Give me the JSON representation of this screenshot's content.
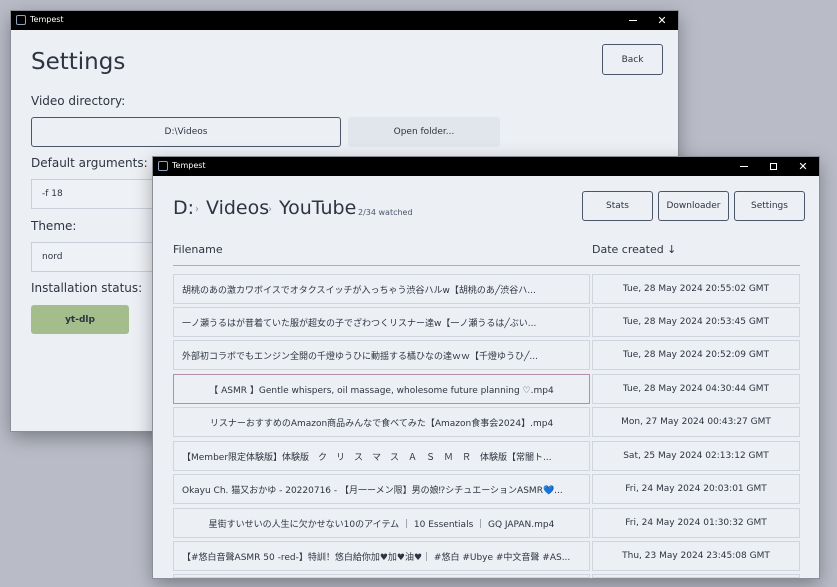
{
  "back_window": {
    "title": "Tempest",
    "heading": "Settings",
    "back_label": "Back",
    "video_directory_label": "Video directory:",
    "video_directory_value": "D:\\Videos",
    "open_folder_label": "Open folder...",
    "default_arguments_label": "Default arguments:",
    "default_arguments_value": "-f 18",
    "theme_label": "Theme:",
    "theme_value": "nord",
    "installation_status_label": "Installation status:",
    "installation_status_value": "yt-dlp",
    "status_color": "#a3be8c"
  },
  "front_window": {
    "title": "Tempest",
    "breadcrumb": [
      "D:",
      "Videos",
      "YouTube"
    ],
    "watched": "2/34 watched",
    "buttons": {
      "stats": "Stats",
      "downloader": "Downloader",
      "settings": "Settings"
    },
    "columns": {
      "filename": "Filename",
      "date_created": "Date created ↓"
    },
    "accent_color": "#88c0d0",
    "rows": [
      {
        "filename": "胡桃のあの激カワボイスでオタクスイッチが入っちゃう渋谷ハルw【胡桃のあ╱渋谷ハ...",
        "date": "Tue, 28 May 2024 20:55:02 GMT"
      },
      {
        "filename": "一ノ瀬うるはが昔着ていた服が超女の子でざわつくリスナー達w【一ノ瀬うるは╱ぶい...",
        "date": "Tue, 28 May 2024 20:53:45 GMT"
      },
      {
        "filename": "外部初コラボでもエンジン全開の千燈ゆうひに動揺する橘ひなの達ｗｗ【千燈ゆうひ╱...",
        "date": "Tue, 28 May 2024 20:52:09 GMT"
      },
      {
        "filename": "【 ASMR 】Gentle whispers, oil massage, wholesome future planning ♡.mp4",
        "date": "Tue, 28 May 2024 04:30:44 GMT"
      },
      {
        "filename": "リスナーおすすめのAmazon商品みんなで食べてみた【Amazon食事会2024】.mp4",
        "date": "Mon, 27 May 2024 00:43:27 GMT"
      },
      {
        "filename": "【Member限定体験版】体験版　ク　リ　ス　マ　ス　Ａ　Ｓ　Ｍ　Ｒ　体験版【常闇ト...",
        "date": "Sat, 25 May 2024 02:13:12 GMT"
      },
      {
        "filename": "Okayu Ch. 猫又おかゆ - 20220716 - 【月一ーメン限】男の娘⁉シチュエーションASMR💙...",
        "date": "Fri, 24 May 2024 20:03:01 GMT"
      },
      {
        "filename": "星街すいせいの人生に欠かせない10のアイテム ｜ 10 Essentials ｜ GQ JAPAN.mp4",
        "date": "Fri, 24 May 2024 01:30:32 GMT"
      },
      {
        "filename": "【#悠白音聲ASMR 50 -red-】特訓！悠白給你加♥加♥油♥｜ #悠白 #Ubye #中文音聲 #AS...",
        "date": "Thu, 23 May 2024 23:45:08 GMT"
      }
    ]
  }
}
